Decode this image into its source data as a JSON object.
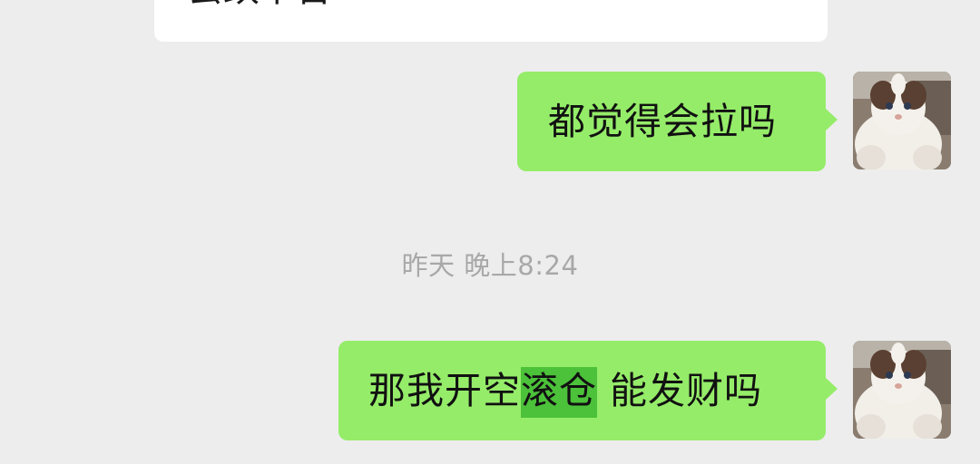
{
  "chat": {
    "incoming_partial_text": "会跌下台",
    "messages": [
      {
        "sender": "self",
        "text": "都觉得会拉吗"
      },
      {
        "sender": "self",
        "text_before": "那我开空",
        "text_highlight": "滚仓",
        "text_after": " 能发财吗"
      }
    ],
    "timestamp": "昨天 晚上8:24"
  },
  "colors": {
    "background": "#ededed",
    "outgoing_bubble": "#95ec69",
    "incoming_bubble": "#ffffff",
    "highlight": "#4cc13a",
    "timestamp_text": "#a8a8a8"
  },
  "avatar": {
    "icon": "cat-avatar"
  }
}
